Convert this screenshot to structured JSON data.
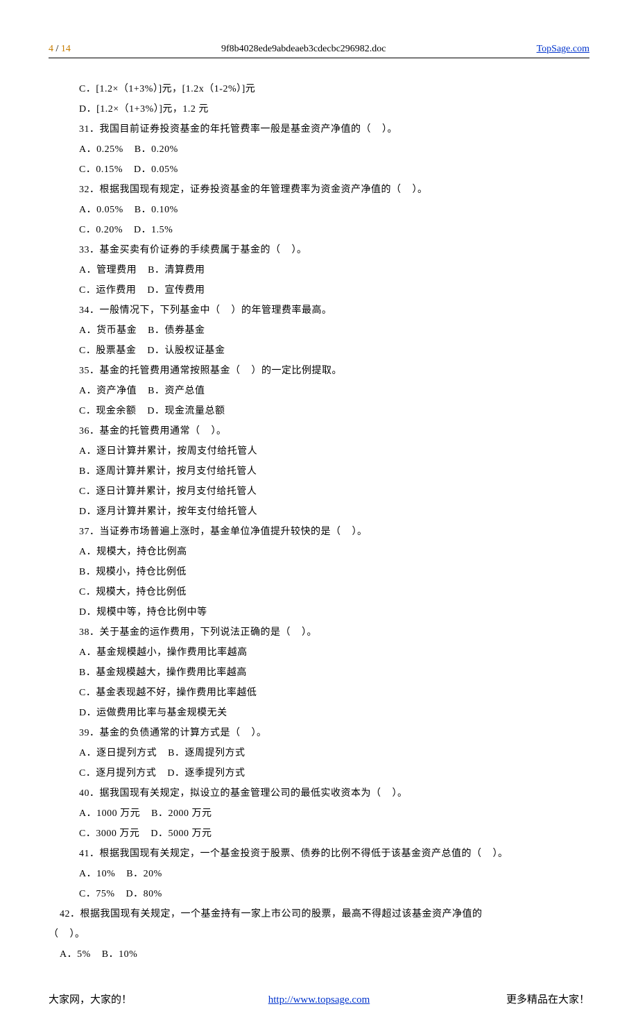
{
  "header": {
    "page_current": "4",
    "page_sep": " / ",
    "page_total": "14",
    "filename": "9f8b4028ede9abdeaeb3cdecbc296982.doc",
    "site": "TopSage.com"
  },
  "lines": [
    "C．[1.2×（1+3%）]元，[1.2x（1-2%）]元",
    "D．[1.2×（1+3%）]元，1.2 元",
    "31．我国目前证券投资基金的年托管费率一般是基金资产净值的（    ）。",
    "A．0.25%    B．0.20%",
    "C．0.15%    D．0.05%",
    "32．根据我国现有规定，证券投资基金的年管理费率为资金资产净值的（    ）。",
    "A．0.05%    B．0.10%",
    "C．0.20%    D．1.5%",
    "33．基金买卖有价证券的手续费属于基金的（    ）。",
    "A．管理费用    B．清算费用",
    "C．运作费用    D．宣传费用",
    "34．一般情况下，下列基金中（    ）的年管理费率最高。",
    "A．货币基金    B．债券基金",
    "C．股票基金    D．认股权证基金",
    "35．基金的托管费用通常按照基金（    ）的一定比例提取。",
    "A．资产净值    B．资产总值",
    "C．现金余额    D．现金流量总额",
    "36．基金的托管费用通常（    ）。",
    "A．逐日计算并累计，按周支付给托管人",
    "B．逐周计算并累计，按月支付给托管人",
    "C．逐日计算并累计，按月支付给托管人",
    "D．逐月计算并累计，按年支付给托管人",
    "37．当证券市场普遍上涨时，基金单位净值提升较快的是（    ）。",
    "A．规模大，持仓比例高",
    "B．规模小，持仓比例低",
    "C．规模大，持仓比例低",
    "D．规模中等，持仓比例中等",
    "38．关于基金的运作费用，下列说法正确的是（    ）。",
    "A．基金规模越小，操作费用比率越高",
    "B．基金规模越大，操作费用比率越高",
    "C．基金表现越不好，操作费用比率越低",
    "D．运做费用比率与基金规模无关",
    "39．基金的负债通常的计算方式是（    ）。",
    "A．逐日提列方式    B．逐周提列方式",
    "C．逐月提列方式    D．逐季提列方式",
    "40．据我国现有关规定，拟设立的基金管理公司的最低实收资本为（    ）。",
    "A．1000 万元    B．2000 万元",
    "C．3000 万元    D．5000 万元",
    "41．根据我国现有关规定，一个基金投资于股票、债券的比例不得低于该基金资产总值的（    ）。",
    "A．10%    B．20%",
    "C．75%    D．80%"
  ],
  "q42": {
    "stem_indent": "    42．根据我国现有关规定，一个基金持有一家上市公司的股票，最高不得超过该基金资产净值的",
    "stem_wrap": "（    ）。",
    "opts": "    A．5%    B．10%"
  },
  "footer": {
    "left": "大家网，大家的！",
    "center": "http://www.topsage.com",
    "right": "更多精品在大家！"
  }
}
